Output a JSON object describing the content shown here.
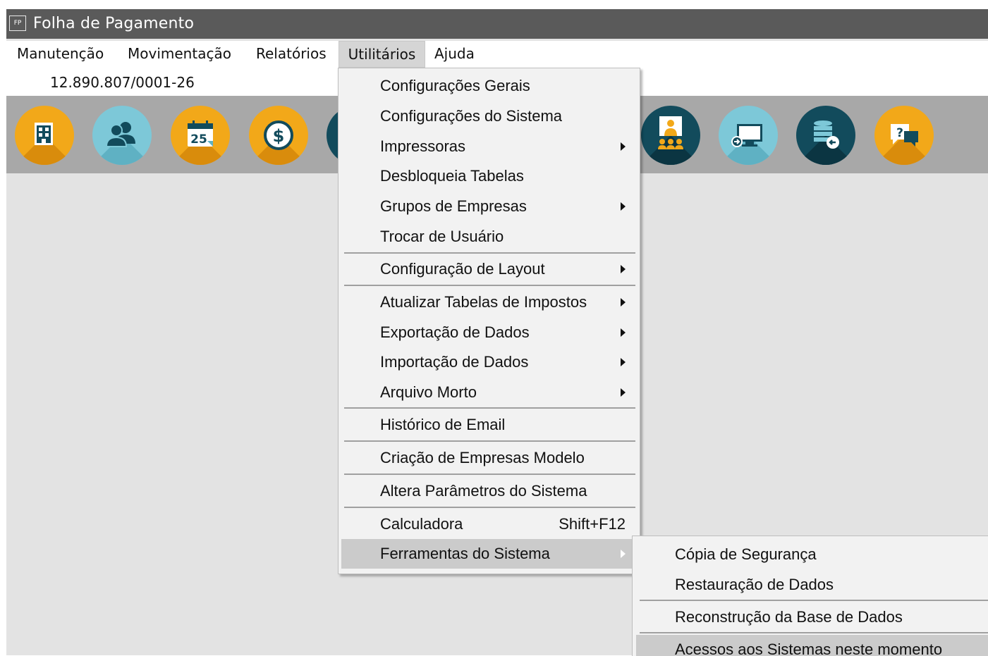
{
  "window": {
    "icon_text": "FP",
    "title": "Folha de Pagamento"
  },
  "menubar": {
    "items": [
      {
        "label": "Manutenção"
      },
      {
        "label": "Movimentação"
      },
      {
        "label": "Relatórios"
      },
      {
        "label": "Utilitários",
        "active": true
      },
      {
        "label": "Ajuda"
      }
    ]
  },
  "company": {
    "cnpj": "12.890.807/0001-26"
  },
  "toolbar": {
    "buttons": [
      {
        "icon": "building-icon",
        "color": "#f2a819"
      },
      {
        "icon": "users-icon",
        "color": "#7dc8d8"
      },
      {
        "icon": "calendar-icon",
        "color": "#f2a819",
        "text": "25"
      },
      {
        "icon": "dollar-icon",
        "color": "#f2a819",
        "text": "$"
      },
      {
        "icon": "hidden-icon",
        "color": "#124b5c"
      },
      {
        "icon": "presentation-icon",
        "color": "#124b5c"
      },
      {
        "icon": "monitor-login-icon",
        "color": "#7dc8d8"
      },
      {
        "icon": "database-restore-icon",
        "color": "#124b5c"
      },
      {
        "icon": "help-chat-icon",
        "color": "#f2a819",
        "text": "?"
      }
    ]
  },
  "utilitarios_menu": {
    "items": [
      {
        "label": "Configurações Gerais",
        "submenu": false
      },
      {
        "label": "Configurações do Sistema",
        "submenu": false
      },
      {
        "label": "Impressoras",
        "submenu": true
      },
      {
        "label": "Desbloqueia Tabelas",
        "submenu": false
      },
      {
        "label": "Grupos de Empresas",
        "submenu": true
      },
      {
        "label": "Trocar de Usuário",
        "submenu": false
      },
      {
        "label": "Configuração de Layout",
        "submenu": true
      },
      {
        "label": "Atualizar Tabelas de Impostos",
        "submenu": true
      },
      {
        "label": "Exportação de Dados",
        "submenu": true
      },
      {
        "label": "Importação de Dados",
        "submenu": true
      },
      {
        "label": "Arquivo Morto",
        "submenu": true
      },
      {
        "label": "Histórico de Email",
        "submenu": false
      },
      {
        "label": "Criação de Empresas Modelo",
        "submenu": false
      },
      {
        "label": "Altera Parâmetros do Sistema",
        "submenu": false
      },
      {
        "label": "Calculadora",
        "shortcut": "Shift+F12",
        "submenu": false
      },
      {
        "label": "Ferramentas do Sistema",
        "submenu": true,
        "highlighted": true
      }
    ]
  },
  "ferramentas_submenu": {
    "items": [
      {
        "label": "Cópia de Segurança"
      },
      {
        "label": "Restauração de Dados"
      },
      {
        "label": "Reconstrução da Base de Dados"
      },
      {
        "label": "Acessos aos Sistemas neste momento",
        "highlighted": true
      }
    ]
  },
  "colors": {
    "titlebar": "#5a5a5a",
    "toolbar": "#a8a8a8",
    "workspace": "#e3e3e3",
    "menu_background": "#f2f2f2",
    "menu_highlight": "#cbcbcb",
    "icon_orange": "#f2a819",
    "icon_light_blue": "#7dc8d8",
    "icon_dark_teal": "#124b5c"
  }
}
